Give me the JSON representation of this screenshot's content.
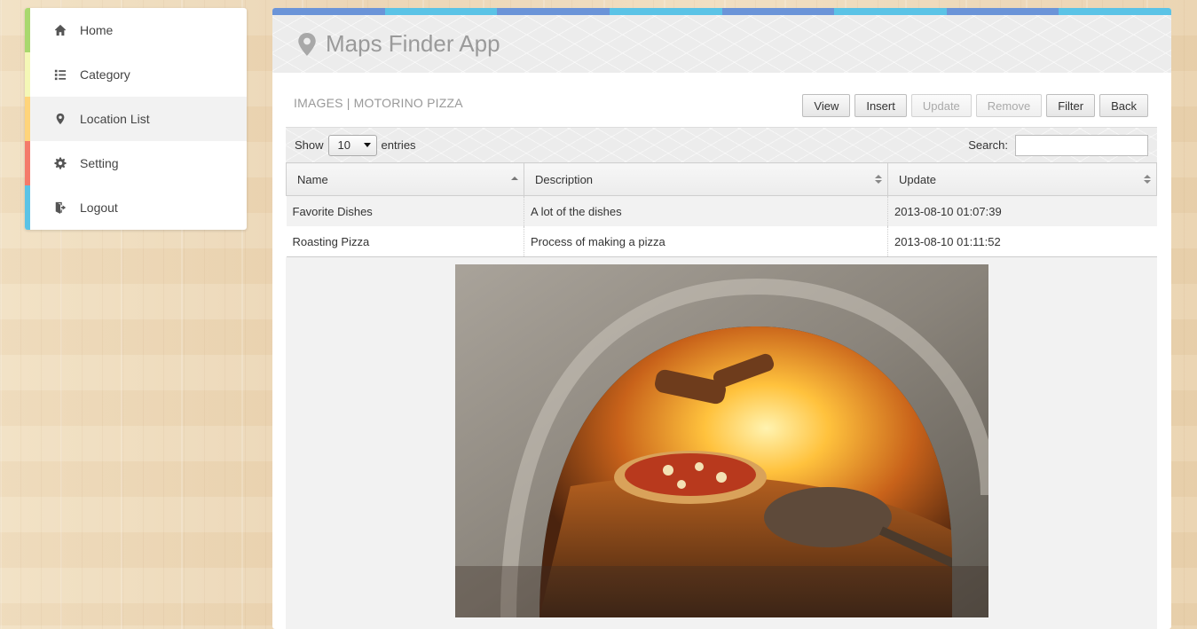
{
  "sidebar": {
    "items": [
      {
        "label": "Home",
        "icon": "home-icon",
        "color": "#a9d86e"
      },
      {
        "label": "Category",
        "icon": "list-icon",
        "color": "#f4f7b6"
      },
      {
        "label": "Location List",
        "icon": "map-marker-icon",
        "color": "#ffd47a"
      },
      {
        "label": "Setting",
        "icon": "gear-icon",
        "color": "#f47a6a"
      },
      {
        "label": "Logout",
        "icon": "logout-icon",
        "color": "#5bc3e6"
      }
    ],
    "active": "Location List"
  },
  "header": {
    "title": "Maps Finder App",
    "stripe_colors": [
      "#6b94d8",
      "#5bc3e6"
    ]
  },
  "section": {
    "title": "IMAGES | MOTORINO PIZZA"
  },
  "toolbar": {
    "view": "View",
    "insert": "Insert",
    "update": "Update",
    "remove": "Remove",
    "filter": "Filter",
    "back": "Back"
  },
  "datatable": {
    "show_label": "Show",
    "entries_value": "10",
    "entries_label": "entries",
    "search_label": "Search:",
    "search_value": "",
    "columns": [
      "Name",
      "Description",
      "Update"
    ],
    "rows": [
      [
        "Favorite Dishes",
        "A lot of the dishes",
        "2013-08-10 01:07:39"
      ],
      [
        "Roasting Pizza",
        "Process of making a pizza",
        "2013-08-10 01:11:52"
      ]
    ]
  }
}
